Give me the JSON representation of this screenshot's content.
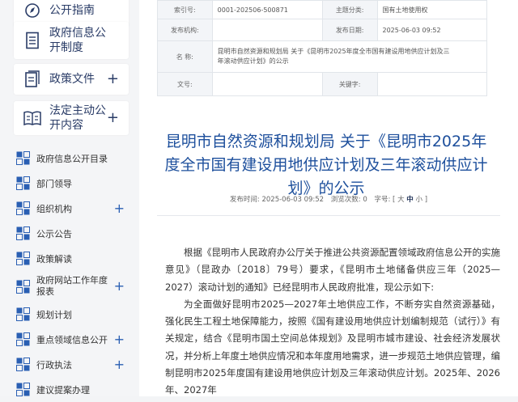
{
  "sidebar": {
    "main_items": [
      {
        "label": "公开指南",
        "icon": "guide-icon",
        "has_plus": false
      },
      {
        "label": "政府信息公开制度",
        "icon": "document-icon",
        "has_plus": false
      },
      {
        "label": "政策文件",
        "icon": "files-icon",
        "has_plus": true
      },
      {
        "label": "法定主动公开内容",
        "icon": "book-icon",
        "has_plus": true
      }
    ],
    "sub_items": [
      {
        "label": "政府信息公开目录",
        "has_plus": false
      },
      {
        "label": "部门领导",
        "has_plus": false
      },
      {
        "label": "组织机构",
        "has_plus": true
      },
      {
        "label": "公示公告",
        "has_plus": false
      },
      {
        "label": "政策解读",
        "has_plus": false
      },
      {
        "label": "政府网站工作年度报表",
        "has_plus": true
      },
      {
        "label": "规划计划",
        "has_plus": false
      },
      {
        "label": "重点领域信息公开",
        "has_plus": true
      },
      {
        "label": "行政执法",
        "has_plus": true
      },
      {
        "label": "建议提案办理",
        "has_plus": false
      }
    ],
    "plus_symbol": "+"
  },
  "meta": {
    "index_label": "索引号:",
    "index_value": "0001-202506-500871",
    "category_label": "主题分类:",
    "category_value": "国有土地使用权",
    "publisher_label": "发布机构:",
    "publisher_value": "",
    "date_label": "发布日期:",
    "date_value": "2025-06-03 09:52",
    "name_label": "名 称:",
    "name_value": "昆明市自然资源和规划局 关于《昆明市2025年度全市国有建设用地供应计划及三年滚动供应计划》的公示",
    "docno_label": "文号:",
    "docno_value": "",
    "keywords_label": "关键字:",
    "keywords_value": ""
  },
  "article": {
    "title": "昆明市自然资源和规划局 关于《昆明市2025年度全市国有建设用地供应计划及三年滚动供应计划》的公示",
    "publish_time": "发布时间: 2025-06-03 09:52",
    "views": "浏览次数: 0",
    "font_size_label": "字号: [",
    "size_large": "大",
    "size_medium": "中",
    "size_small": "小",
    "bracket_close": "]",
    "paragraphs": [
      "根据《昆明市人民政府办公厅关于推进公共资源配置领域政府信息公开的实施意见》（昆政办〔2018〕79号）要求，《昆明市土地储备供应三年（2025—2027）滚动计划的通知》已经昆明市人民政府批准，现公示如下:",
      "为全面做好昆明市2025—2027年土地供应工作，不断夯实自然资源基础，强化民生工程土地保障能力，按照《国有建设用地供应计划编制规范（试行）》有关规定，结合《昆明市国土空间总体规划》及昆明市城市建设、社会经济发展状况，并分析上年度土地供应情况和本年度用地需求，进一步规范土地供应管理，编制昆明市2025年度国有建设用地供应计划及三年滚动供应计划。2025年、2026年、2027年"
    ]
  },
  "colors": {
    "accent": "#1d4f9c",
    "nav_text": "#2a3c67",
    "plus": "#2a5fb3"
  }
}
